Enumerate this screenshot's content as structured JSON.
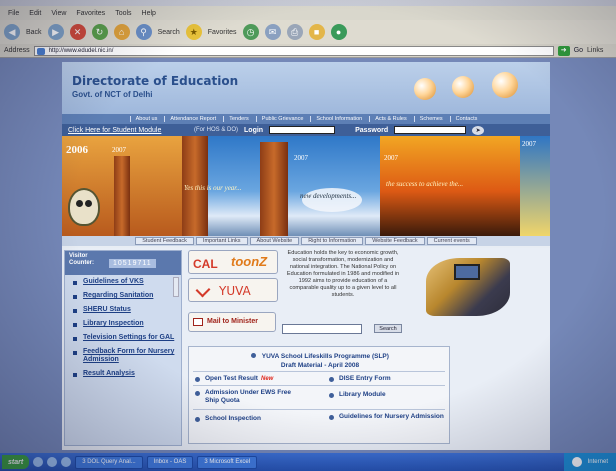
{
  "browser": {
    "menu": [
      "File",
      "Edit",
      "View",
      "Favorites",
      "Tools",
      "Help"
    ],
    "toolbar": {
      "back_label": "Back",
      "search_label": "Search",
      "favorites_label": "Favorites"
    },
    "address_label": "Address",
    "url": "http://www.edudel.nic.in/",
    "go_label": "Go",
    "links_label": "Links"
  },
  "site": {
    "title": "Directorate of Education",
    "subtitle": "Govt. of NCT of Delhi",
    "nav": [
      "About us",
      "Attendance Report",
      "Tenders",
      "Public Grievance",
      "School Information",
      "Acts & Rules",
      "Schemes",
      "Contacts"
    ],
    "student_link": "Click Here for Student Module",
    "login_note": "(For HOS & DO)",
    "login_label": "Login",
    "password_label": "Password",
    "banner": {
      "year_big": "2006",
      "years": [
        "2007",
        "2007",
        "2007",
        "2007"
      ],
      "captions": [
        "Yes this is our year...",
        "new developments...",
        "the success to achieve the..."
      ]
    },
    "subnav": [
      "Student Feedback",
      "Important Links",
      "About Website",
      "Right to Information",
      "Website Feedback",
      "Current events"
    ]
  },
  "sidebar": {
    "visitor_label": "Visitor Counter:",
    "visitor_count": "10519711",
    "links": [
      "Guidelines of VKS",
      "Regarding Sanitation",
      "SHERU Status",
      "Library Inspection",
      "Television Settings for GAL",
      "Feedback Form for Nursery Admission",
      "Result Analysis"
    ]
  },
  "main": {
    "caltoonz": [
      "CAL",
      "toonZ"
    ],
    "yuva": "YUVA",
    "mail_label": "Mail to Minister",
    "intro": "Education holds the key to economic growth, social transformation, modernization and national integration. The National Policy on Education formulated in 1986 and modified in 1992 aims to provide education of a comparable quality up to a given level to all students.",
    "search_button": "Search",
    "slp_title": "YUVA School Lifeskills Programme (SLP)",
    "slp_subtitle": "Draft Material - April 2008",
    "items": [
      "Open Test Result",
      "DISE Entry Form",
      "Admission Under EWS Free Ship Quota",
      "Library Module",
      "School Inspection",
      "Guidelines for Nursery Admission"
    ],
    "new_badge": "New"
  },
  "taskbar": {
    "start": "start",
    "tasks": [
      "3 DOL Query Anal...",
      "Inbox - OAS",
      "3 Microsoft Excel"
    ],
    "tray": "Internet"
  },
  "colors": {
    "header_bg": "#9fb8dc",
    "navbar_bg": "#5d7fb5",
    "link": "#1d3f85",
    "accent": "#d43a2a"
  }
}
